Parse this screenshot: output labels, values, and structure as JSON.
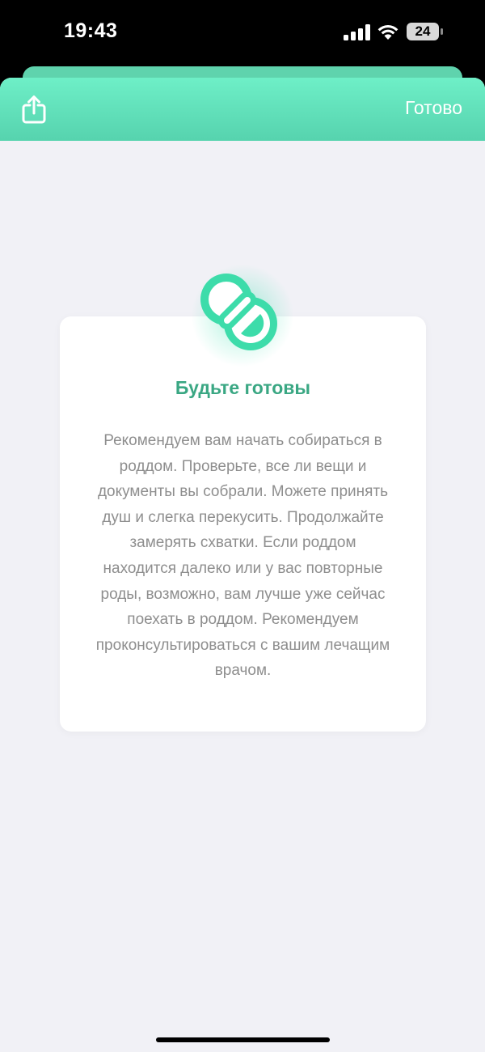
{
  "status_bar": {
    "time": "19:43",
    "battery_level": "24",
    "signal_icon": "cellular-signal-icon",
    "wifi_icon": "wifi-icon",
    "battery_icon": "battery-icon"
  },
  "nav": {
    "share_icon": "share-icon",
    "done_label": "Готово"
  },
  "card": {
    "icon": "pacifier-icon",
    "title": "Будьте готовы",
    "body": "Рекомендуем вам начать собираться в роддом. Проверьте, все ли вещи и документы вы собрали. Можете принять душ и слегка перекусить. Продолжайте замерять схватки. Если роддом находится далеко или у вас повторные роды, возможно, вам лучше уже сейчас поехать в роддом. Рекомендуем проконсультироваться с вашим лечащим врачом."
  },
  "colors": {
    "accent": "#3aa783",
    "nav_gradient_top": "#6eefc7",
    "nav_gradient_bottom": "#56d3ae",
    "background": "#f1f1f6",
    "body_text": "#8e8e8e"
  }
}
